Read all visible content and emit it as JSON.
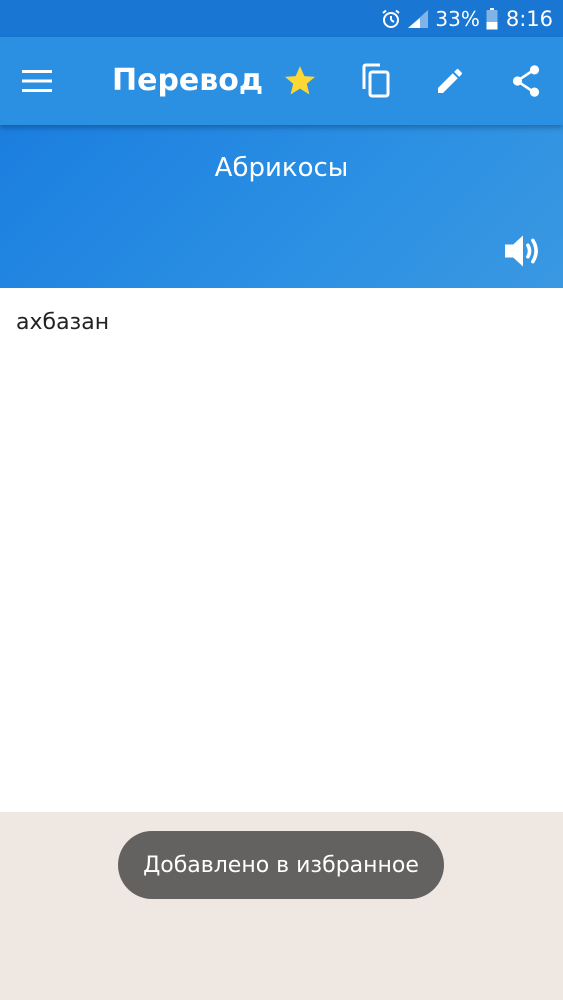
{
  "status_bar": {
    "battery_percent": "33%",
    "time": "8:16",
    "icons": [
      "alarm-icon",
      "signal-icon",
      "battery-icon"
    ]
  },
  "app_bar": {
    "title": "Перевод",
    "icons": [
      "menu-icon",
      "star-icon",
      "copy-icon",
      "edit-icon",
      "share-icon"
    ]
  },
  "source": {
    "text": "Абрикосы",
    "icon": "speaker-icon"
  },
  "result": {
    "text": "ахбазан"
  },
  "toast": {
    "message": "Добавлено в избранное"
  },
  "colors": {
    "status_bar": "#1976d2",
    "app_bar": "#2b8fe2",
    "star": "#fdd835",
    "toast_bg": "#636261",
    "bottom_bg": "#efe7e1"
  }
}
